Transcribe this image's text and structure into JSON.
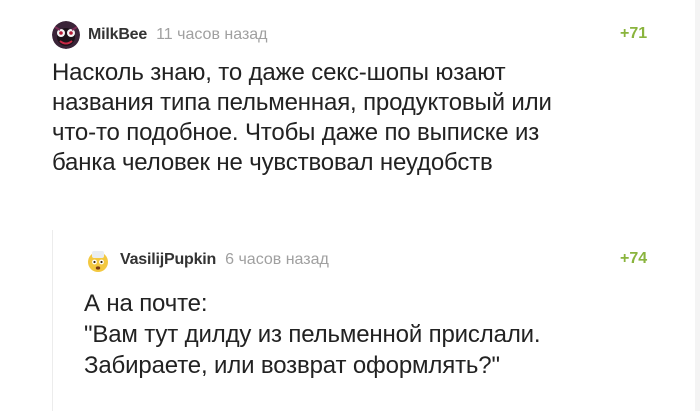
{
  "comments": [
    {
      "avatar_icon": "dark-creature-avatar-icon",
      "username": "MilkBee",
      "time": "11 часов назад",
      "rating": "+71",
      "text": "Насколь знаю, то даже секс-шопы юзают\nназвания типа пельменная, продуктовый или\nчто-то подобное. Чтобы даже по выписке из\nбанка человек не чувствовал неудобств"
    },
    {
      "avatar_icon": "yellow-face-avatar-icon",
      "username": "VasilijPupkin",
      "time": "6 часов назад",
      "rating": "+74",
      "text": "А на почте:\n\"Вам тут дилду из пельменной прислали.\nЗабираете, или возврат оформлять?\""
    }
  ],
  "colors": {
    "rating": "#8ab43d",
    "username": "#333333",
    "time": "#a0a0a0",
    "text": "#222222"
  }
}
